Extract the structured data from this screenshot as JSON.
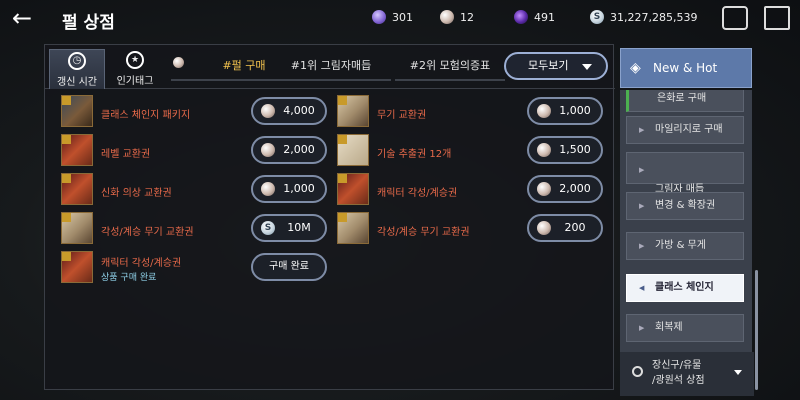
{
  "header": {
    "title": "펄 상점",
    "currencies": [
      {
        "icon": "moonstone-icon",
        "value": "301"
      },
      {
        "icon": "pearl-icon",
        "value": "12"
      },
      {
        "icon": "shadow-coin-icon",
        "value": "491"
      },
      {
        "icon": "silver-icon",
        "symbol": "S",
        "value": "31,227,285,539"
      }
    ]
  },
  "tabs": {
    "refresh": "갱신 시간",
    "popular": "인기태그",
    "pearl_buy": "#펄 구매",
    "shadow_battle": "#1위 그림자매듭",
    "adventure": "#2위 모험의증표",
    "filter": "모두보기"
  },
  "items_left": [
    {
      "name": "클래스 체인지 패키지",
      "price": "4,000",
      "coin": "pearl",
      "thumb": "box"
    },
    {
      "name": "레벨 교환권",
      "price": "2,000",
      "coin": "pearl",
      "thumb": "ticket"
    },
    {
      "name": "신화 의상 교환권",
      "price": "1,000",
      "coin": "pearl",
      "thumb": "ticket"
    },
    {
      "name": "각성/계승 무기 교환권",
      "price": "10M",
      "coin": "silver",
      "thumb": "scroll"
    },
    {
      "name": "캐릭터 각성/계승권",
      "sub": "상품 구매 완료",
      "price": "구매 완료",
      "thumb": "ticket"
    }
  ],
  "items_right": [
    {
      "name": "무기 교환권",
      "price": "1,000",
      "coin": "pearl",
      "thumb": "scroll"
    },
    {
      "name": "기술 추출권 12개",
      "price": "1,500",
      "coin": "pearl",
      "thumb": "paper"
    },
    {
      "name": "캐릭터 각성/계승권",
      "price": "2,000",
      "coin": "pearl",
      "thumb": "ticket"
    },
    {
      "name": "각성/계승 무기 교환권",
      "price": "200",
      "coin": "pearl",
      "thumb": "scroll"
    }
  ],
  "sidebar": {
    "new_hot": "New & Hot",
    "items": [
      {
        "label": "은화로 구매"
      },
      {
        "label": "마일리지로 구매"
      },
      {
        "label": "그림자 매듭\n& 크론석"
      },
      {
        "label": "변경 & 확장권"
      },
      {
        "label": "가방 & 무게"
      },
      {
        "label": "클래스 체인지",
        "active": true
      },
      {
        "label": "회복제"
      }
    ],
    "bottom": "장신구/유물\n/광원석 상점"
  }
}
